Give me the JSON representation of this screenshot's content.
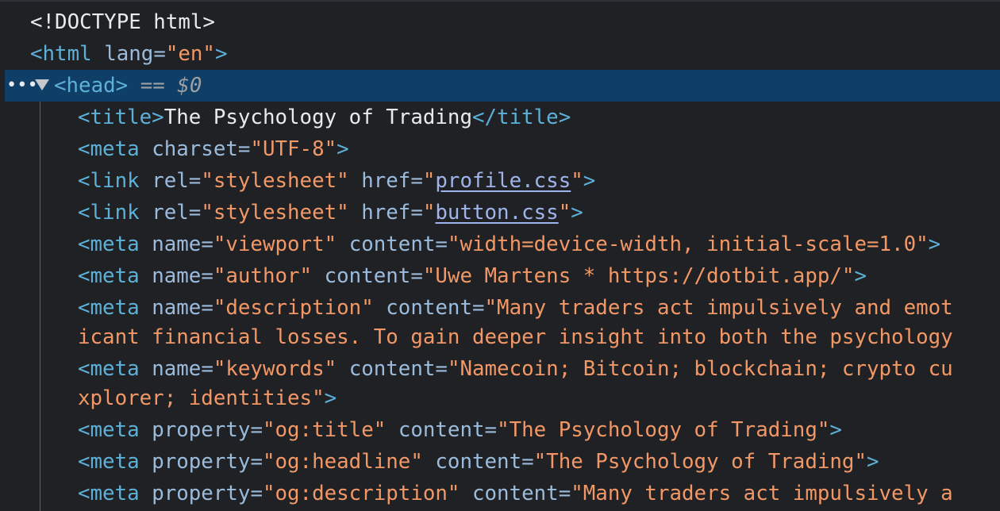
{
  "doctype": "<!DOCTYPE html>",
  "html_tag": {
    "open": "<html",
    "attr": "lang",
    "eq": "=",
    "value": "\"en\"",
    "close": ">"
  },
  "head": {
    "dots": "•••",
    "tag": "<head>",
    "suffix": "== $0"
  },
  "lines": {
    "title": {
      "open": "<title>",
      "text": "The Psychology of Trading",
      "close": "</title>"
    },
    "charset": {
      "open": "<meta",
      "attr": "charset",
      "value": "\"UTF-8\"",
      "close": ">"
    },
    "link1": {
      "open": "<link",
      "attr1": "rel",
      "value1": "\"stylesheet\"",
      "attr2": "href",
      "quote_open": "\"",
      "href": "profile.css",
      "quote_close": "\"",
      "close": ">"
    },
    "link2": {
      "open": "<link",
      "attr1": "rel",
      "value1": "\"stylesheet\"",
      "attr2": "href",
      "quote_open": "\"",
      "href": "button.css",
      "quote_close": "\"",
      "close": ">"
    },
    "viewport": {
      "open": "<meta",
      "attr1": "name",
      "value1": "\"viewport\"",
      "attr2": "content",
      "value2": "\"width=device-width, initial-scale=1.0\"",
      "close": ">"
    },
    "author": {
      "open": "<meta",
      "attr1": "name",
      "value1": "\"author\"",
      "attr2": "content",
      "value2": "\"Uwe Martens * https://dotbit.app/\"",
      "close": ">"
    },
    "description": {
      "open": "<meta",
      "attr1": "name",
      "value1": "\"description\"",
      "attr2": "content",
      "value2": "\"Many traders act impulsively and emot",
      "wrap": "icant financial losses. To gain deeper insight into both the psychology"
    },
    "keywords": {
      "open": "<meta",
      "attr1": "name",
      "value1": "\"keywords\"",
      "attr2": "content",
      "value2": "\"Namecoin; Bitcoin; blockchain; crypto cu",
      "wrap": "xplorer; identities\"",
      "close": ">"
    },
    "og_title": {
      "open": "<meta",
      "attr1": "property",
      "value1": "\"og:title\"",
      "attr2": "content",
      "value2": "\"The Psychology of Trading\"",
      "close": ">"
    },
    "og_headline": {
      "open": "<meta",
      "attr1": "property",
      "value1": "\"og:headline\"",
      "attr2": "content",
      "value2": "\"The Psychology of Trading\"",
      "close": ">"
    },
    "og_description": {
      "open": "<meta",
      "attr1": "property",
      "value1": "\"og:description\"",
      "attr2": "content",
      "value2": "\"Many traders act impulsively a"
    }
  },
  "colors": {
    "background": "#202124",
    "selection": "#0f3e66",
    "tag": "#5db0d7",
    "attribute": "#9bbbdc",
    "value": "#f29766",
    "text": "#e8eaed",
    "link": "#9fb4e9"
  }
}
